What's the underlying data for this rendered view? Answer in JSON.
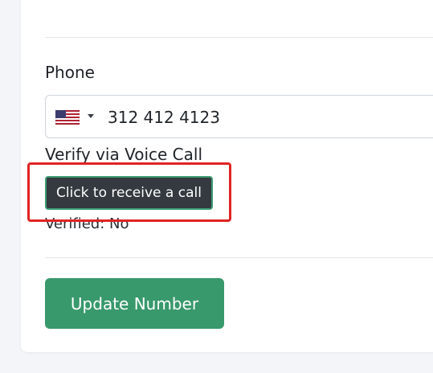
{
  "phone": {
    "label": "Phone",
    "country_flag_icon": "us-flag-icon",
    "value": "312 412 4123"
  },
  "verify": {
    "label": "Verify via Voice Call",
    "button_label": "Click to receive a call",
    "status_text": "Verified: No"
  },
  "actions": {
    "update_label": "Update Number"
  },
  "colors": {
    "primary_green": "#38996c",
    "dark_button": "#343a40",
    "highlight_red": "#e02424"
  }
}
